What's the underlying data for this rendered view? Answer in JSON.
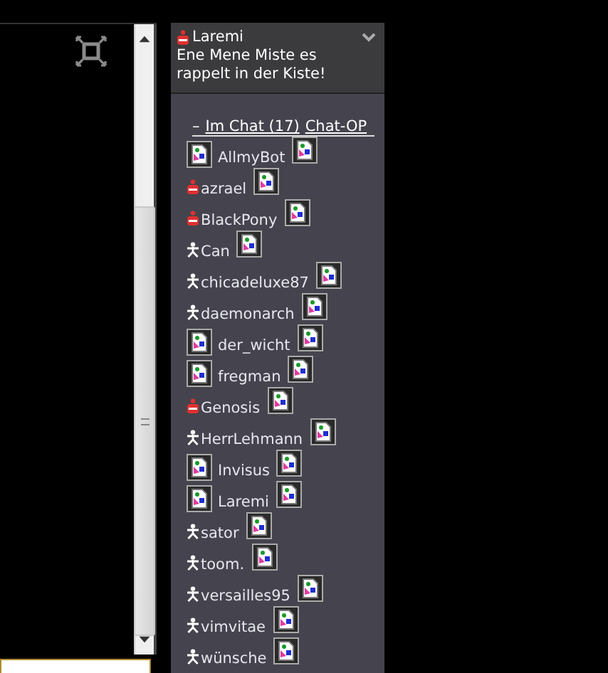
{
  "header": {
    "user": {
      "name": "Laremi",
      "kind": "blocked"
    },
    "status": "Ene Mene Miste es rappelt in der Kiste!"
  },
  "group": {
    "toggle": "–",
    "title": "Im Chat (17)",
    "role": "Chat-OP",
    "expanded": true
  },
  "users": [
    {
      "name": "AllmyBot",
      "kind": "image"
    },
    {
      "name": "azrael",
      "kind": "blocked"
    },
    {
      "name": "BlackPony",
      "kind": "blocked"
    },
    {
      "name": "Can",
      "kind": "person"
    },
    {
      "name": "chicadeluxe87",
      "kind": "person"
    },
    {
      "name": "daemonarch",
      "kind": "person"
    },
    {
      "name": "der_wicht",
      "kind": "image"
    },
    {
      "name": "fregman",
      "kind": "image"
    },
    {
      "name": "Genosis",
      "kind": "blocked"
    },
    {
      "name": "HerrLehmann",
      "kind": "person"
    },
    {
      "name": "Invisus",
      "kind": "image"
    },
    {
      "name": "Laremi",
      "kind": "image"
    },
    {
      "name": "sator",
      "kind": "person"
    },
    {
      "name": "toom.",
      "kind": "person"
    },
    {
      "name": "versailles95",
      "kind": "person"
    },
    {
      "name": "vimvitae",
      "kind": "person"
    },
    {
      "name": "wünsche",
      "kind": "person"
    }
  ]
}
